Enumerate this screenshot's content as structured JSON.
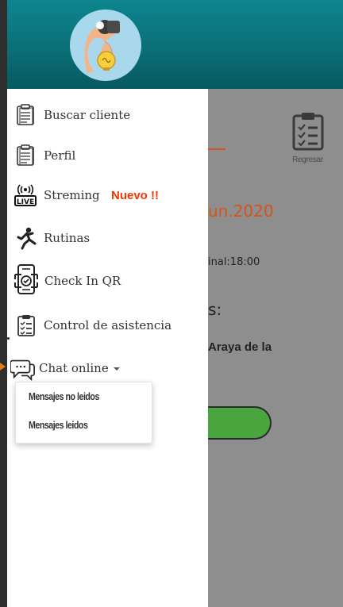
{
  "menu": {
    "items": [
      {
        "label": "Buscar cliente",
        "icon": "clipboard-icon"
      },
      {
        "label": "Perfil",
        "icon": "clipboard-icon"
      },
      {
        "label": "Streming",
        "icon": "live-broadcast-icon",
        "badge": "Nuevo !!"
      },
      {
        "label": "Rutinas",
        "icon": "exercise-icon"
      },
      {
        "label": "Check In QR",
        "icon": "phone-qr-check-icon"
      },
      {
        "label": "Control de asistencia",
        "icon": "checklist-icon"
      },
      {
        "label": "Chat online",
        "icon": "chat-bubbles-icon"
      }
    ],
    "dropdown": [
      "Mensajes no leidos",
      "Mensajes leidos"
    ]
  },
  "background": {
    "regresar": "Regresar",
    "date": "un.2020",
    "time": "inal:18:00",
    "colon": "s:",
    "name": "Araya de la"
  },
  "colors": {
    "header": "#0a6f77",
    "accent_orange": "#d4541b",
    "badge_red": "#ff3300",
    "button_green": "#4aa53e"
  }
}
